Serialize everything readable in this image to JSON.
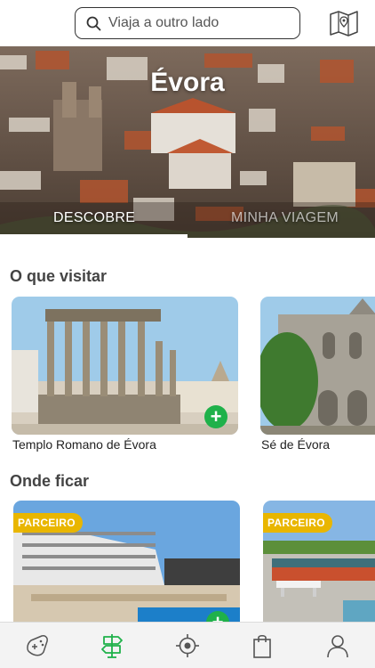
{
  "search": {
    "placeholder": "Viaja a outro lado",
    "icon": "search-icon"
  },
  "header": {
    "map_icon": "map-icon"
  },
  "hero": {
    "title": "Évora",
    "tabs": [
      {
        "label": "DESCOBRE",
        "active": true
      },
      {
        "label": "MINHA VIAGEM",
        "active": false
      }
    ]
  },
  "visit": {
    "title": "O que visitar",
    "items": [
      {
        "name": "Templo Romano de Évora"
      },
      {
        "name": "Sé de Évora"
      }
    ]
  },
  "stay": {
    "title": "Onde ficar",
    "items": [
      {
        "badge": "PARCEIRO"
      },
      {
        "badge": "PARCEIRO"
      }
    ]
  },
  "nav": {
    "items": [
      {
        "icon": "game-controller-icon",
        "active": false
      },
      {
        "icon": "signpost-icon",
        "active": true
      },
      {
        "icon": "location-target-icon",
        "active": false
      },
      {
        "icon": "shopping-bag-icon",
        "active": false
      },
      {
        "icon": "profile-icon",
        "active": false
      }
    ]
  },
  "colors": {
    "accent": "#1fb14a",
    "badge": "#e9b600",
    "text": "#222222"
  }
}
